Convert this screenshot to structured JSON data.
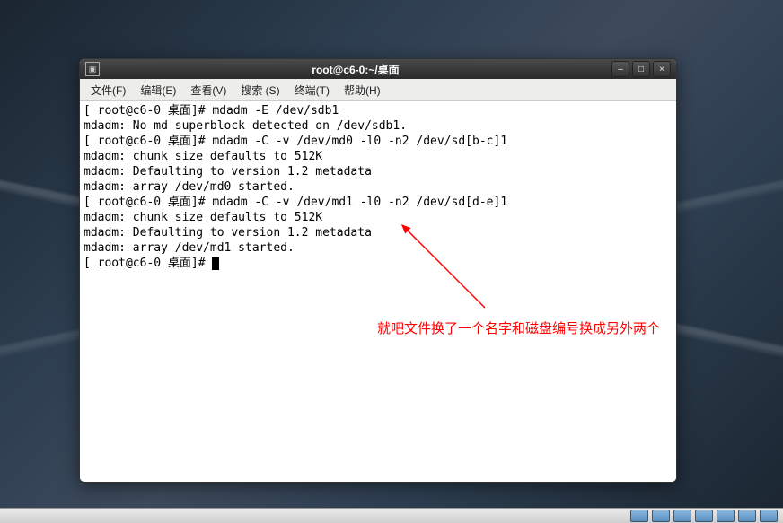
{
  "window": {
    "title": "root@c6-0:~/桌面"
  },
  "menubar": {
    "file": "文件(F)",
    "edit": "编辑(E)",
    "view": "查看(V)",
    "search": "搜索 (S)",
    "terminal": "终端(T)",
    "help": "帮助(H)"
  },
  "terminal": {
    "lines": [
      "[ root@c6-0 桌面]# mdadm -E /dev/sdb1",
      "mdadm: No md superblock detected on /dev/sdb1.",
      "[ root@c6-0 桌面]# mdadm -C -v /dev/md0 -l0 -n2 /dev/sd[b-c]1",
      "mdadm: chunk size defaults to 512K",
      "mdadm: Defaulting to version 1.2 metadata",
      "mdadm: array /dev/md0 started.",
      "[ root@c6-0 桌面]# mdadm -C -v /dev/md1 -l0 -n2 /dev/sd[d-e]1",
      "mdadm: chunk size defaults to 512K",
      "mdadm: Defaulting to version 1.2 metadata",
      "mdadm: array /dev/md1 started.",
      "[ root@c6-0 桌面]# "
    ]
  },
  "annotation": {
    "text": "就吧文件换了一个名字和磁盘编号换成另外两个"
  },
  "controls": {
    "minimize": "–",
    "maximize": "□",
    "close": "×"
  }
}
